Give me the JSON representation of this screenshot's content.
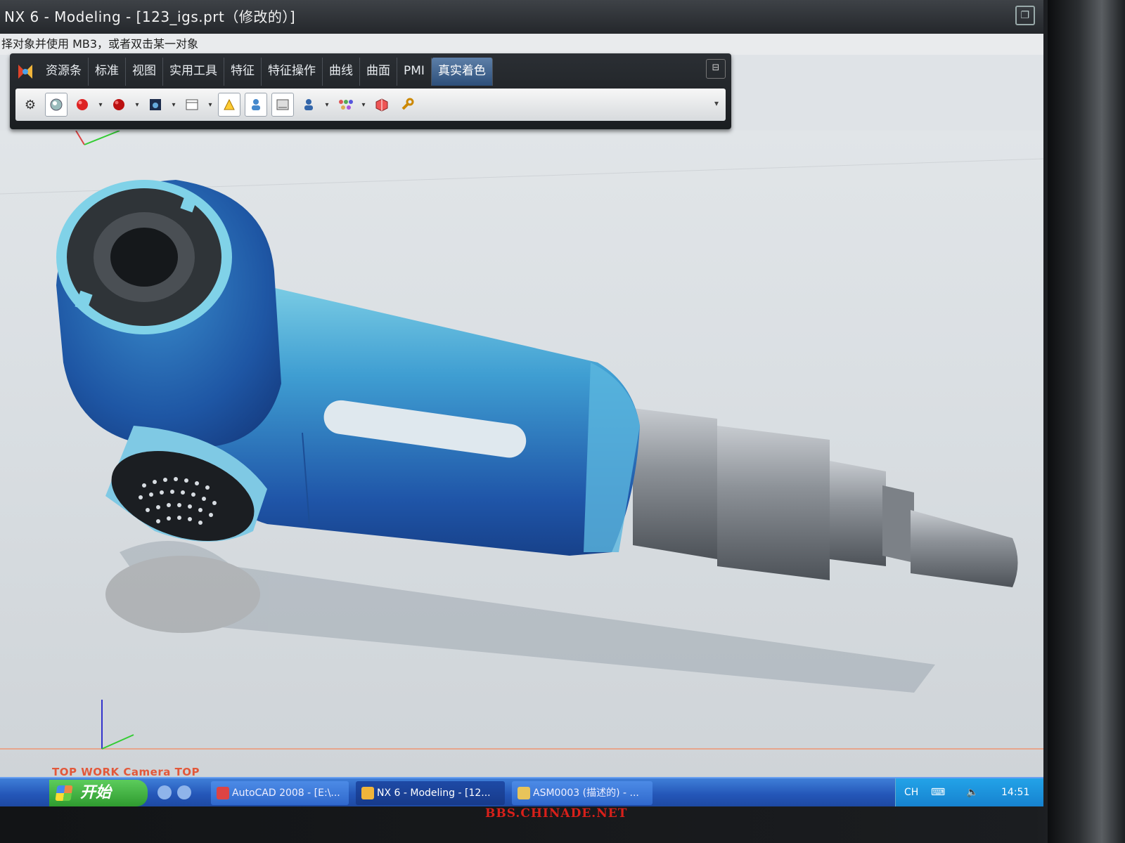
{
  "window": {
    "title": "NX 6 - Modeling - [123_igs.prt（修改的）]"
  },
  "cue_line": "择对象并使用 MB3，或者双击某一对象",
  "ribbon": {
    "tabs": [
      {
        "label": "资源条"
      },
      {
        "label": "标准"
      },
      {
        "label": "视图"
      },
      {
        "label": "实用工具"
      },
      {
        "label": "特征"
      },
      {
        "label": "特征操作"
      },
      {
        "label": "曲线"
      },
      {
        "label": "曲面"
      },
      {
        "label": "PMI"
      },
      {
        "label": "真实着色",
        "active": true
      }
    ]
  },
  "viewport": {
    "status_text": "TOP WORK Camera TOP"
  },
  "taskbar": {
    "start_label": "开始",
    "buttons": [
      {
        "label": "AutoCAD 2008 - [E:\\..."
      },
      {
        "label": "NX 6 - Modeling - [12...",
        "active": true
      },
      {
        "label": "ASM0003 (描述的) - ..."
      }
    ],
    "tray": {
      "lang": "CH",
      "time": "14:51"
    }
  },
  "watermark": "BBS.CHINADE.NET",
  "colors": {
    "tool_body": "#2f7fc4",
    "tool_dark": "#1f4f9a",
    "metal": "#8d9298",
    "ribbon_active": "#3d6595",
    "status_text": "#e2583a",
    "watermark": "#d8201a"
  }
}
